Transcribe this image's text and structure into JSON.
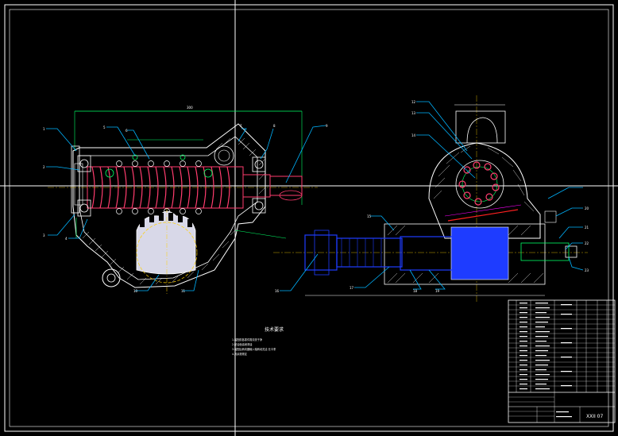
{
  "drawing": {
    "colors": {
      "background": "#000000",
      "frame": "#ffffff",
      "crosshair": "#ffffff",
      "body_outline": "#ffffff",
      "hatch": "#ffffff",
      "worm": "#ff3c6e",
      "dimension": "#00ff66",
      "leader": "#00b4ff",
      "blue_part": "#1e3cff",
      "gear_fill": "#d8d8e8",
      "magenta": "#ff00ff",
      "red_line": "#ff2020",
      "cyan_line": "#00e5ff",
      "yellow_mark": "#ffd000"
    },
    "notes": {
      "title": "技术要求",
      "lines": [
        "1.装配前各零件需清洗干净",
        "2.配合面涂润滑油",
        "3.装配后转向器输入轴转动灵活 无卡滞",
        "4.其余按规定"
      ]
    },
    "title_block": {
      "main_label": "XXII 07"
    }
  }
}
